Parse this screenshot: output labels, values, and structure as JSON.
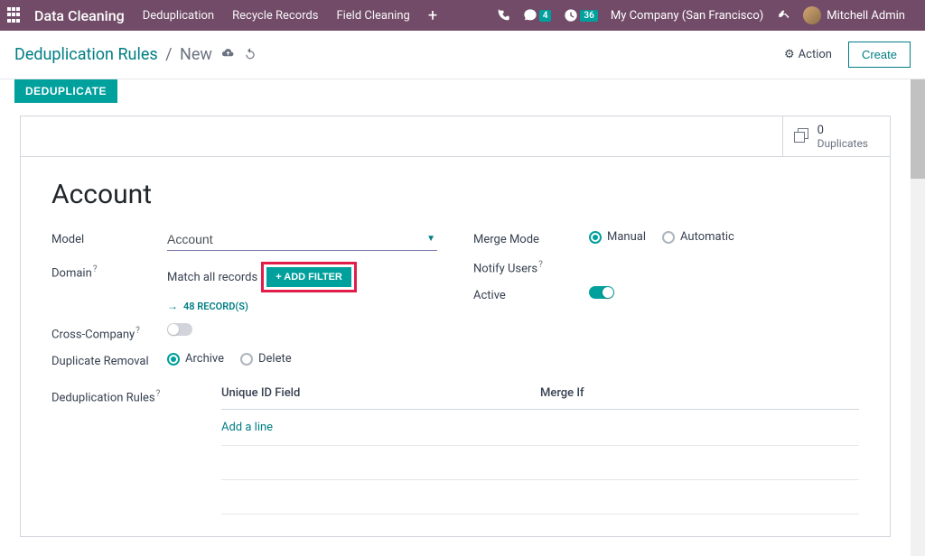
{
  "topbar": {
    "app_name": "Data Cleaning",
    "menu": [
      "Deduplication",
      "Recycle Records",
      "Field Cleaning"
    ],
    "messages_badge": "4",
    "activities_badge": "36",
    "company": "My Company (San Francisco)",
    "user": "Mitchell Admin"
  },
  "subheader": {
    "breadcrumb_root": "Deduplication Rules",
    "breadcrumb_current": "New",
    "action_label": "Action",
    "create_label": "Create"
  },
  "status": {
    "deduplicate_btn": "DEDUPLICATE"
  },
  "sheet": {
    "duplicates_count": "0",
    "duplicates_label": "Duplicates",
    "title": "Account",
    "labels": {
      "model": "Model",
      "domain": "Domain",
      "cross_company": "Cross-Company",
      "duplicate_removal": "Duplicate Removal",
      "dedup_rules": "Deduplication Rules",
      "merge_mode": "Merge Mode",
      "notify_users": "Notify Users",
      "active": "Active"
    },
    "model_value": "Account",
    "domain_match_text": "Match all records",
    "add_filter_btn": "+ ADD FILTER",
    "records_link": "48 RECORD(S)",
    "removal_options": {
      "archive": "Archive",
      "delete": "Delete"
    },
    "merge_options": {
      "manual": "Manual",
      "automatic": "Automatic"
    },
    "rules_table": {
      "col1": "Unique ID Field",
      "col2": "Merge If",
      "add_line": "Add a line"
    }
  }
}
